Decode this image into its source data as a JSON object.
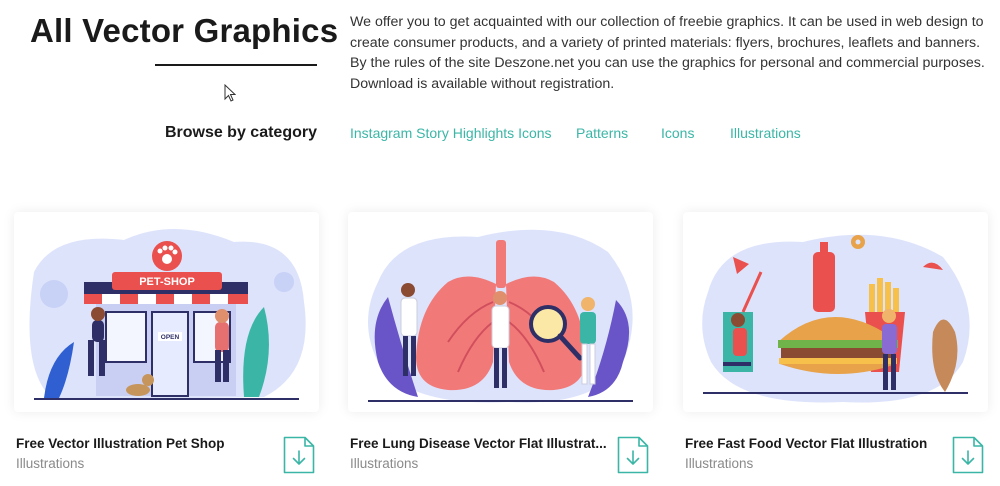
{
  "header": {
    "title": "All Vector Graphics",
    "intro": "We offer you to get acquainted with our collection of freebie graphics. It can be used in web design to create consumer products, and a variety of printed materials: flyers, brochures, leaflets and banners. By the rules of the site Deszone.net you can use the graphics for personal and commercial purposes. Download is available without registration."
  },
  "browse": {
    "label": "Browse by category",
    "categories": [
      "Instagram Story Highlights Icons",
      "Patterns",
      "Icons",
      "Illustrations"
    ]
  },
  "cards": [
    {
      "title": "Free Vector Illustration Pet Shop",
      "category": "Illustrations",
      "sign_text": "PET-SHOP",
      "door_text": "OPEN"
    },
    {
      "title": "Free Lung Disease Vector Flat Illustrat...",
      "category": "Illustrations"
    },
    {
      "title": "Free Fast Food Vector Flat Illustration",
      "category": "Illustrations"
    }
  ],
  "colors": {
    "accent": "#3bb6a6",
    "title": "#1a1a1a",
    "muted": "#8a8a8a"
  },
  "icons": {
    "download": "download-icon",
    "cursor": "mouse-cursor-icon"
  }
}
